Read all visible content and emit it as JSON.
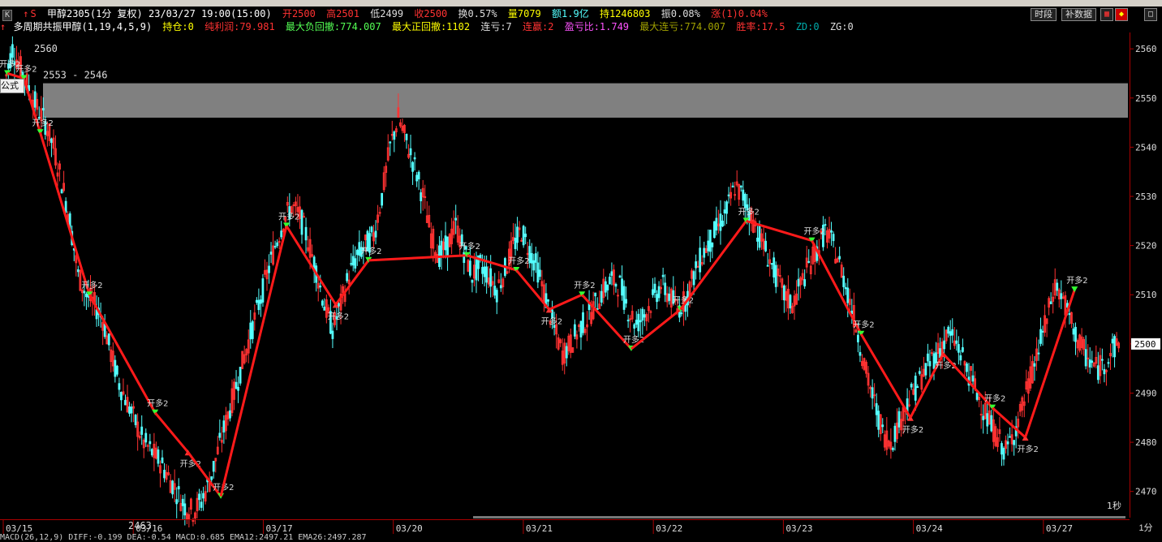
{
  "header": {
    "k_button": "K",
    "symbol": "甲醇2305(1分 复权) 23/03/27 19:00(15:00)",
    "open": "开2500",
    "high": "高2501",
    "low": "低2499",
    "close": "收2500",
    "turnover": "换0.57%",
    "volume": "量7079",
    "amount": "额1.9亿",
    "position": "持1246803",
    "amplitude": "振0.08%",
    "change": "涨(1)0.04%"
  },
  "indicator": {
    "name": "多周期共振甲醇(1,19,4,5,9)",
    "hold": "持仓:0",
    "net_profit": "纯利润:79.981",
    "max_drawdown": "最大负回撤:774.007",
    "max_positive": "最大正回撤:1102",
    "loss_streak": "连亏:7",
    "win_streak": "连赢:2",
    "pl_ratio": "盈亏比:1.749",
    "max_loss_streak": "最大连亏:774.007",
    "win_rate": "胜率:17.5",
    "zd": "ZD:0",
    "zg": "ZG:0"
  },
  "buttons": {
    "timeframe": "时段",
    "supplement": "补数据"
  },
  "popup_label": "公式",
  "corner_label": "1分",
  "timer_label": "1秒",
  "status_text": "MACD(26,12,9) DIFF:-0.199 DEA:-0.54 MACD:0.685 EMA12:2497.21 EMA26:2497.287",
  "colors": {
    "up": "#ff3232",
    "down": "#54ffff",
    "axis": "#aa0000",
    "trend": "#ff1a1a",
    "band": "#808080"
  },
  "chart_data": {
    "type": "candlestick",
    "ylim": [
      2465,
      2563
    ],
    "yticks": [
      2470,
      2480,
      2490,
      2500,
      2510,
      2520,
      2530,
      2540,
      2550,
      2560
    ],
    "current_price": 2500,
    "dates": [
      "03/15",
      "03/16",
      "03/17",
      "03/20",
      "03/21",
      "03/22",
      "03/23",
      "03/24",
      "03/27"
    ],
    "band": {
      "label": "2553 - 2546",
      "low": 2546,
      "high": 2553
    },
    "extremes": {
      "high_label": "2560",
      "low_label": "2463"
    },
    "price_path": [
      2553,
      2560,
      2556,
      2552,
      2548,
      2545,
      2540,
      2533,
      2525,
      2514,
      2510,
      2508,
      2505,
      2498,
      2492,
      2488,
      2484,
      2480,
      2478,
      2476,
      2473,
      2470,
      2467,
      2466,
      2468,
      2472,
      2478,
      2484,
      2490,
      2496,
      2502,
      2508,
      2514,
      2520,
      2525,
      2528,
      2526,
      2521,
      2515,
      2508,
      2503,
      2508,
      2514,
      2518,
      2520,
      2522,
      2530,
      2540,
      2546,
      2541,
      2536,
      2530,
      2522,
      2518,
      2520,
      2524,
      2519,
      2514,
      2516,
      2514,
      2511,
      2515,
      2520,
      2523,
      2519,
      2515,
      2509,
      2503,
      2498,
      2500,
      2503,
      2505,
      2508,
      2511,
      2513,
      2512,
      2507,
      2504,
      2506,
      2509,
      2512,
      2510,
      2507,
      2509,
      2514,
      2518,
      2521,
      2524,
      2527,
      2532,
      2530,
      2526,
      2522,
      2518,
      2514,
      2510,
      2508,
      2512,
      2516,
      2519,
      2523,
      2520,
      2515,
      2509,
      2502,
      2494,
      2488,
      2482,
      2480,
      2484,
      2488,
      2491,
      2494,
      2497,
      2499,
      2502,
      2500,
      2496,
      2492,
      2488,
      2484,
      2481,
      2478,
      2482,
      2487,
      2493,
      2499,
      2505,
      2512,
      2509,
      2504,
      2500,
      2497,
      2495,
      2496,
      2499,
      2500
    ],
    "trades": [
      {
        "i": 0,
        "p": 2555,
        "dir": "down",
        "label": "开多2"
      },
      {
        "i": 2,
        "p": 2554,
        "dir": "down",
        "label": "开多2"
      },
      {
        "i": 4,
        "p": 2543,
        "dir": "down",
        "label": "开多2"
      },
      {
        "i": 10,
        "p": 2510,
        "dir": "down",
        "label": "开多2"
      },
      {
        "i": 18,
        "p": 2486,
        "dir": "down",
        "label": "开多2"
      },
      {
        "i": 22,
        "p": 2478,
        "dir": "up",
        "label": "开多2"
      },
      {
        "i": 26,
        "p": 2469,
        "dir": "down",
        "label": "开多2"
      },
      {
        "i": 34,
        "p": 2524,
        "dir": "down",
        "label": "开多2"
      },
      {
        "i": 40,
        "p": 2508,
        "dir": "up",
        "label": "开多2"
      },
      {
        "i": 44,
        "p": 2517,
        "dir": "down",
        "label": "开多2"
      },
      {
        "i": 56,
        "p": 2518,
        "dir": "down",
        "label": "开多2"
      },
      {
        "i": 62,
        "p": 2515,
        "dir": "down",
        "label": "开多2"
      },
      {
        "i": 66,
        "p": 2507,
        "dir": "up",
        "label": "开多2"
      },
      {
        "i": 70,
        "p": 2510,
        "dir": "down",
        "label": "开多2"
      },
      {
        "i": 76,
        "p": 2499,
        "dir": "down",
        "label": "开多2"
      },
      {
        "i": 82,
        "p": 2507,
        "dir": "down",
        "label": "开多2"
      },
      {
        "i": 90,
        "p": 2525,
        "dir": "down",
        "label": "开多2"
      },
      {
        "i": 98,
        "p": 2521,
        "dir": "down",
        "label": "开多2"
      },
      {
        "i": 104,
        "p": 2502,
        "dir": "down",
        "label": "开多2"
      },
      {
        "i": 110,
        "p": 2485,
        "dir": "up",
        "label": "开多2"
      },
      {
        "i": 114,
        "p": 2498,
        "dir": "up",
        "label": "开多2"
      },
      {
        "i": 120,
        "p": 2487,
        "dir": "down",
        "label": "开多2"
      },
      {
        "i": 124,
        "p": 2481,
        "dir": "up",
        "label": "开多2"
      },
      {
        "i": 130,
        "p": 2511,
        "dir": "down",
        "label": "开多2"
      }
    ]
  }
}
